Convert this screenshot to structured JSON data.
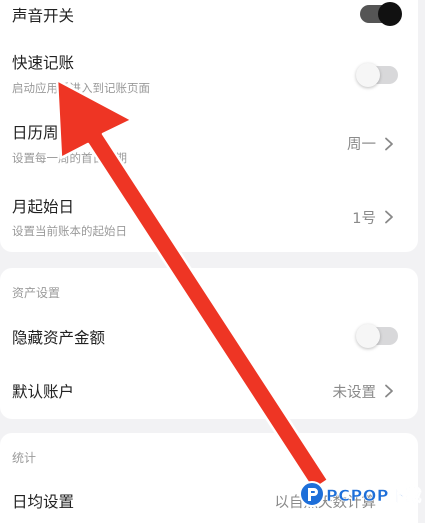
{
  "settings": {
    "sound": {
      "title": "声音开关",
      "toggle": true
    },
    "quick_entry": {
      "title": "快速记账",
      "subtitle": "启动应用后进入到记账页面",
      "toggle": false
    },
    "week_start": {
      "title": "日历周首日",
      "subtitle": "设置每一周的首日日期",
      "value": "周一"
    },
    "month_start": {
      "title": "月起始日",
      "subtitle": "设置当前账本的起始日",
      "value": "1号"
    }
  },
  "assets": {
    "section_title": "资产设置",
    "hide_amount": {
      "title": "隐藏资产金额",
      "toggle": false
    },
    "default_account": {
      "title": "默认账户",
      "value": "未设置"
    }
  },
  "stats": {
    "section_title": "统计",
    "daily_avg": {
      "title": "日均设置",
      "value": "以自然天数计算"
    }
  },
  "watermark": {
    "text": "PCPOP下载"
  },
  "colors": {
    "background": "#f2f2f4",
    "card": "#ffffff",
    "arrow": "#ee3524",
    "toggle_on_track": "#555555",
    "toggle_on_knob": "#111111",
    "toggle_off_track": "#d8d8da",
    "watermark": "#1e6fd9"
  },
  "icons": {
    "chevron": "chevron-right-icon",
    "annotation": "red-arrow-annotation",
    "logo": "pcpop-logo-icon"
  }
}
